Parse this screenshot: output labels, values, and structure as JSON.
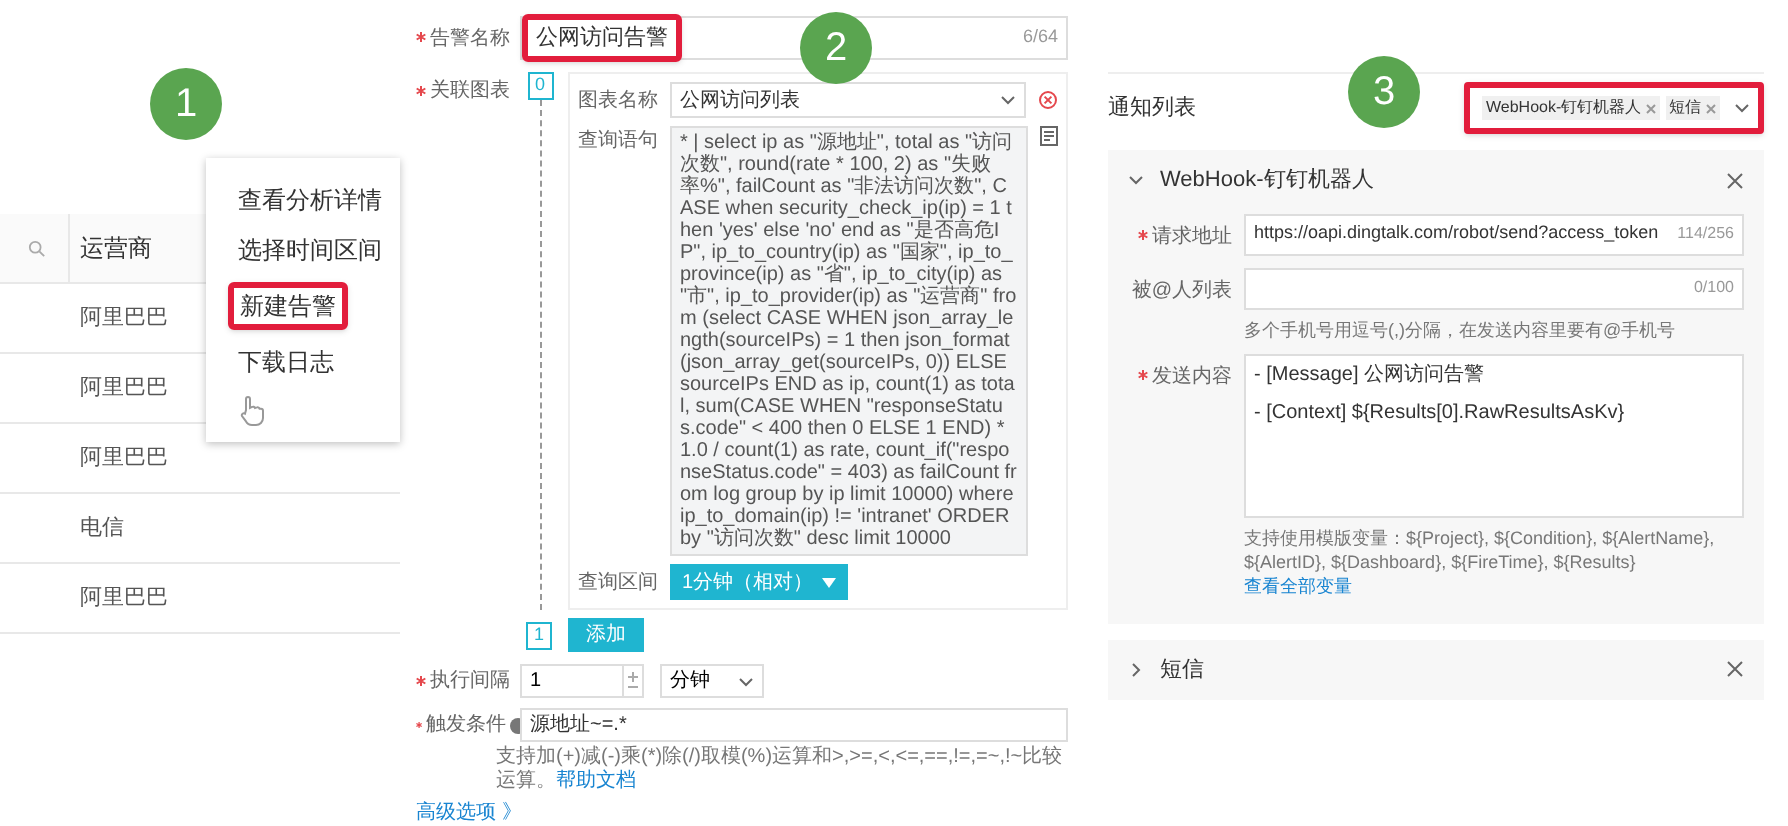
{
  "steps": [
    "1",
    "2",
    "3"
  ],
  "panel1": {
    "column": "运营商",
    "rows": [
      "阿里巴巴",
      "阿里巴巴",
      "阿里巴巴",
      "电信",
      "阿里巴巴"
    ],
    "menu": [
      {
        "label": "查看分析详情",
        "highlighted": false
      },
      {
        "label": "选择时间区间",
        "highlighted": false
      },
      {
        "label": "新建告警",
        "highlighted": true
      },
      {
        "label": "下载日志",
        "highlighted": false
      }
    ]
  },
  "panel2": {
    "alert_name": {
      "label": "告警名称",
      "value": "公网访问告警",
      "counter": "6/64",
      "highlighted": true
    },
    "charts_label": "关联图表",
    "charts": [
      {
        "index": "0",
        "name_label": "图表名称",
        "name": "公网访问列表",
        "query_label": "查询语句",
        "query": "* | select ip as \"源地址\", total as \"访问次数\", round(rate * 100, 2) as \"失败率%\", failCount as \"非法访问次数\", CASE when security_check_ip(ip) = 1 then 'yes' else 'no' end as \"是否高危IP\", ip_to_country(ip) as \"国家\", ip_to_province(ip) as \"省\", ip_to_city(ip) as \"市\", ip_to_provider(ip) as \"运营商\" from (select CASE WHEN json_array_length(sourceIPs) = 1 then json_format(json_array_get(sourceIPs, 0)) ELSE sourceIPs END as ip, count(1) as total, sum(CASE WHEN \"responseStatus.code\" < 400 then 0 ELSE 1 END) * 1.0 / count(1) as rate, count_if(\"responseStatus.code\" = 403) as failCount from log group by ip limit 10000) where ip_to_domain(ip) != 'intranet' ORDER by \"访问次数\" desc limit 10000",
        "range_label": "查询区间",
        "range": "1分钟（相对）"
      }
    ],
    "add_index": "1",
    "add_button": "添加",
    "interval": {
      "label": "执行间隔",
      "value": "1",
      "unit": "分钟"
    },
    "trigger": {
      "label": "触发条件",
      "value": "源地址~=.*",
      "help": "支持加(+)减(-)乘(*)除(/)取模(%)运算和>,>=,<,<=,==,!=,=~,!~比较运算。",
      "link": "帮助文档"
    },
    "advanced": "高级选项 》"
  },
  "panel3": {
    "label": "通知列表",
    "tags": [
      "WebHook-钉钉机器人",
      "短信"
    ],
    "highlighted": true,
    "sections": [
      {
        "title": "WebHook-钉钉机器人",
        "expanded": true,
        "fields": [
          {
            "kind": "input",
            "label": "请求地址",
            "required": true,
            "value": "https://oapi.dingtalk.com/robot/send?access_token",
            "counter": "114/256"
          },
          {
            "kind": "input",
            "label": "被@人列表",
            "required": false,
            "counter": "0/100",
            "hint": "多个手机号用逗号(,)分隔，在发送内容里要有@手机号"
          },
          {
            "kind": "textarea",
            "label": "发送内容",
            "required": true,
            "lines": [
              "- [Message] 公网访问告警",
              "- [Context] ${Results[0].RawResultsAsKv}"
            ],
            "hint": "支持使用模版变量：${Project}, ${Condition}, ${AlertName}, ${AlertID}, ${Dashboard}, ${FireTime}, ${Results}",
            "link": "查看全部变量"
          }
        ]
      },
      {
        "title": "短信",
        "expanded": false
      }
    ]
  }
}
